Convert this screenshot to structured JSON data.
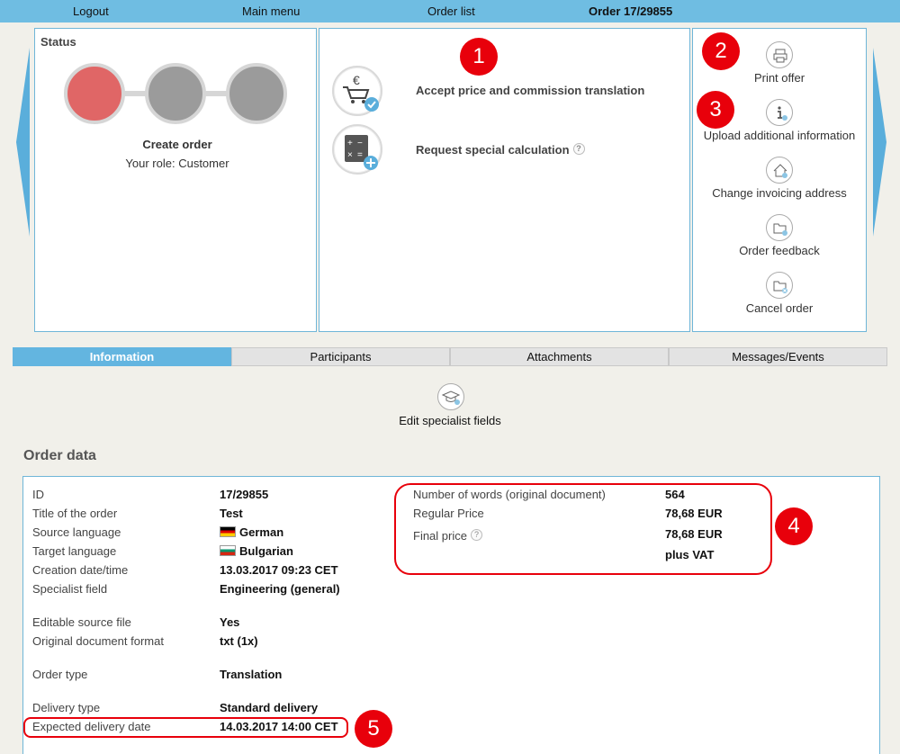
{
  "nav": {
    "logout": "Logout",
    "main_menu": "Main menu",
    "order_list": "Order list",
    "order_title": "Order 17/29855"
  },
  "status": {
    "title": "Status",
    "step": "Create order",
    "role": "Your role: Customer",
    "steps_total": 3,
    "active_step": 1,
    "active_color": "#e06666",
    "inactive_color": "#9b9b9b"
  },
  "actions": {
    "accept_label": "Accept price and commission translation",
    "accept_icon": "cart-euro-check-icon",
    "special_label": "Request special calculation",
    "special_icon": "calculator-plus-icon",
    "help_glyph": "?"
  },
  "side_menu": {
    "print": "Print offer",
    "upload": "Upload additional information",
    "invoicing": "Change invoicing address",
    "feedback": "Order feedback",
    "cancel": "Cancel order"
  },
  "markers": [
    "1",
    "2",
    "3",
    "4",
    "5"
  ],
  "tabs": {
    "information": "Information",
    "participants": "Participants",
    "attachments": "Attachments",
    "messages": "Messages/Events"
  },
  "edit_specialist": "Edit specialist fields",
  "order_data": {
    "title": "Order data",
    "id_label": "ID",
    "id_value": "17/29855",
    "title_label": "Title of the order",
    "title_value": "Test",
    "source_label": "Source language",
    "source_value": "German",
    "target_label": "Target language",
    "target_value": "Bulgarian",
    "created_label": "Creation date/time",
    "created_value": "13.03.2017 09:23 CET",
    "field_label": "Specialist field",
    "field_value": "Engineering (general)",
    "editable_label": "Editable source file",
    "editable_value": "Yes",
    "format_label": "Original document format",
    "format_value": "txt (1x)",
    "type_label": "Order type",
    "type_value": "Translation",
    "delivery_label": "Delivery type",
    "delivery_value": "Standard delivery",
    "expected_label": "Expected delivery date",
    "expected_value": "14.03.2017 14:00 CET",
    "words_label": "Number of words (original document)",
    "words_value": "564",
    "regular_label": "Regular Price",
    "regular_value": "78,68 EUR",
    "final_label": "Final price",
    "final_value": "78,68 EUR",
    "vat_value": "plus VAT"
  },
  "colors": {
    "nav_bg": "#6fbde2",
    "accent": "#63b5e0",
    "marker": "#e8000b"
  }
}
